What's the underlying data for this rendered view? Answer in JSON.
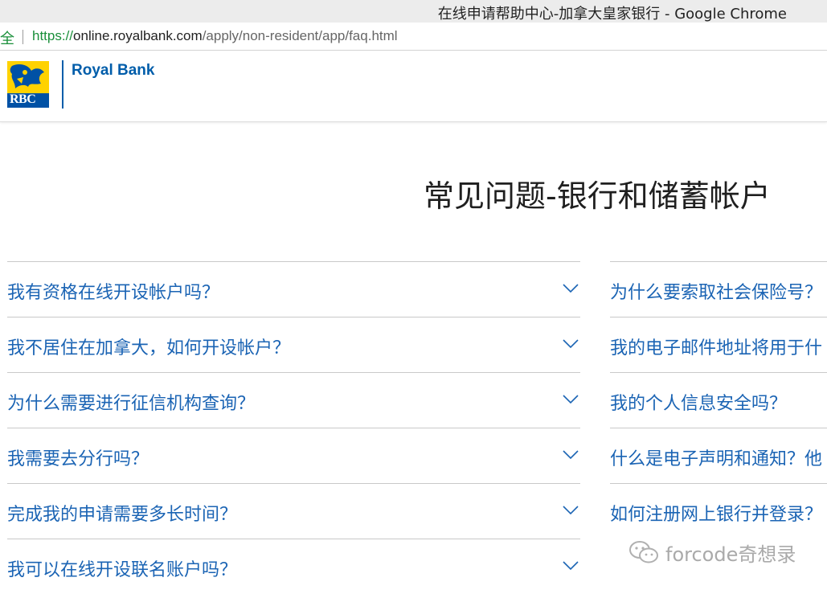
{
  "browser": {
    "window_title": "在线申请帮助中心-加拿大皇家银行 - Google Chrome",
    "secure_label": "全",
    "url": {
      "scheme": "https://",
      "host": "online.royalbank.com",
      "path": "/apply/non-resident/app/faq.html"
    }
  },
  "header": {
    "logo_text": "RBC",
    "brand_name": "Royal Bank",
    "brand_color": "#005daa"
  },
  "page": {
    "title": "常见问题-银行和储蓄帐户"
  },
  "faq": {
    "left": [
      "我有资格在线开设帐户吗？",
      "我不居住在加拿大，如何开设帐户？",
      "为什么需要进行征信机构查询？",
      "我需要去分行吗？",
      "完成我的申请需要多长时间？",
      "我可以在线开设联名账户吗？"
    ],
    "right": [
      "为什么要索取社会保险号？",
      "我的电子邮件地址将用于什",
      "我的个人信息安全吗？",
      "什么是电子声明和通知？他",
      "如何注册网上银行并登录？"
    ],
    "link_color": "#1b64b4",
    "expand_icon": "chevron-down-icon"
  },
  "watermark": {
    "text": "forcode奇想录",
    "icon": "wechat-icon"
  }
}
